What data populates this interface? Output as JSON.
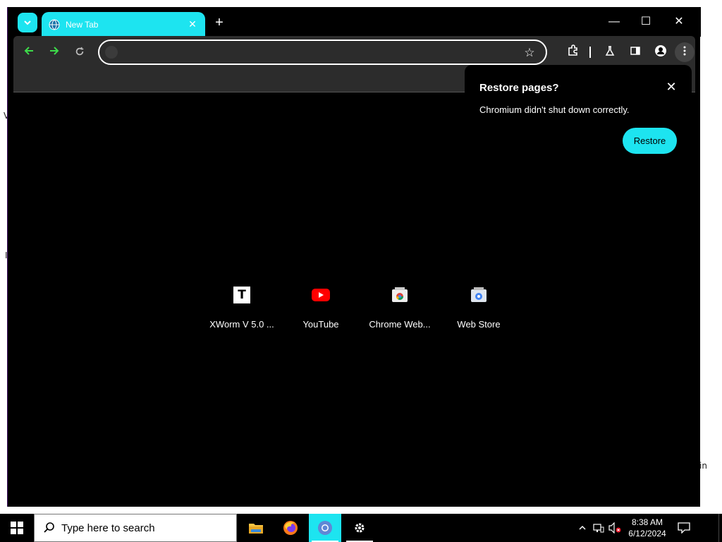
{
  "desktop": {
    "fragments": [
      "V",
      "I",
      "in"
    ]
  },
  "browser": {
    "tab": {
      "title": "New Tab"
    },
    "omnibox": {
      "value": "",
      "placeholder": ""
    },
    "window_controls": {
      "minimize": "—",
      "maximize": "☐",
      "close": "✕"
    },
    "accent_color": "#1de4f0"
  },
  "shortcuts": [
    {
      "label": "XWorm V 5.0 ...",
      "icon": "letter-t-icon"
    },
    {
      "label": "YouTube",
      "icon": "youtube-icon"
    },
    {
      "label": "Chrome Web...",
      "icon": "chrome-web-store-icon"
    },
    {
      "label": "Web Store",
      "icon": "web-store-icon"
    }
  ],
  "restore_popup": {
    "title": "Restore pages?",
    "message": "Chromium didn't shut down correctly.",
    "button": "Restore"
  },
  "taskbar": {
    "search_placeholder": "Type here to search",
    "time": "8:38 AM",
    "date": "6/12/2024"
  }
}
